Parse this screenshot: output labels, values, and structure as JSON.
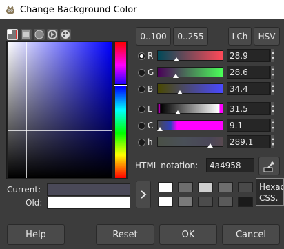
{
  "window": {
    "title": "Change Background Color"
  },
  "tabs": [
    {
      "name": "gimp-selector-tab-icon"
    },
    {
      "name": "cmyk-selector-tab-icon"
    },
    {
      "name": "watercolor-selector-tab-icon"
    },
    {
      "name": "wheel-selector-tab-icon"
    },
    {
      "name": "palette-selector-tab-icon"
    }
  ],
  "range": {
    "btn_100": "0..100",
    "btn_255": "0..255"
  },
  "model": {
    "lch": "LCh",
    "hsv": "HSV"
  },
  "channels": [
    {
      "label": "R",
      "value": "28.9",
      "fraction": 0.289,
      "selected": true
    },
    {
      "label": "G",
      "value": "28.6",
      "fraction": 0.286,
      "selected": false
    },
    {
      "label": "B",
      "value": "34.4",
      "fraction": 0.344,
      "selected": false
    },
    {
      "label": "L",
      "value": "31.5",
      "fraction": 0.315,
      "selected": false
    },
    {
      "label": "C",
      "value": "9.1",
      "fraction": 0.046,
      "selected": false
    },
    {
      "label": "h",
      "value": "289.1",
      "fraction": 0.803,
      "selected": false
    }
  ],
  "html": {
    "label": "HTML notation:",
    "value": "4a4958"
  },
  "current": {
    "label": "Current:",
    "color": "#4a4958"
  },
  "old": {
    "label": "Old:",
    "color": "#ffffff"
  },
  "history": [
    [
      "#ffffff",
      "#6e6e6e",
      "#cfcfcf",
      "#6e6e6e",
      "#4a4a4a"
    ],
    [
      "#ffffff",
      "#7a7a7a",
      "#4c4c4c",
      "#5a5a5a",
      "#1a1a1a"
    ]
  ],
  "tooltip": {
    "line1": "Hexad",
    "line2": "CSS."
  },
  "buttons": {
    "help": "Help",
    "reset": "Reset",
    "ok": "OK",
    "cancel": "Cancel"
  }
}
